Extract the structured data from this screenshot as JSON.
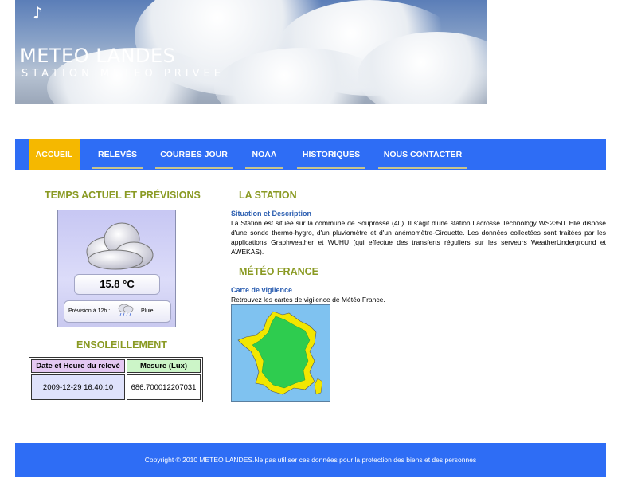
{
  "banner": {
    "note_symbol": "♪",
    "title": "METEO LANDES",
    "subtitle": "STATION METEO PRIVEE"
  },
  "nav": {
    "items": [
      "ACCUEIL",
      "RELEVÉS",
      "COURBES JOUR",
      "NOAA",
      "HISTORIQUES",
      "NOUS CONTACTER"
    ],
    "active": "ACCUEIL"
  },
  "left": {
    "weather_heading": "TEMPS ACTUEL ET PRÉVISIONS",
    "temperature": "15.8 °C",
    "forecast_label": "Prévision à 12h :",
    "forecast_value": "Pluie",
    "sun_heading": "ENSOLEILLEMENT",
    "sun_table": {
      "headers": [
        "Date et Heure du relevé",
        "Mesure (Lux)"
      ],
      "rows": [
        [
          "2009-12-29 16:40:10",
          "686.700012207031"
        ]
      ]
    }
  },
  "right": {
    "station_heading": "LA STATION",
    "station_sub": "Situation et Description",
    "station_text": "La Station est située sur la commune de Souprosse (40). Il s'agit d'une station Lacrosse Technology WS2350. Elle dispose d'une sonde thermo-hygro, d'un pluviomètre et d'un anémomètre-Girouette. Les données collectées sont traitées par les applications Graphweather et WUHU (qui effectue des transferts réguliers sur les serveurs WeatherUnderground et AWEKAS).",
    "france_heading": "MÉTÉO FRANCE",
    "france_sub": "Carte de vigilence",
    "france_text": "Retrouvez les cartes de vigilence de Météo France."
  },
  "footer": {
    "text": "Copyright © 2010 METEO LANDES.Ne pas utiliser ces données pour la protection des biens et des personnes"
  },
  "colors": {
    "nav_blue": "#2e6df5",
    "active_tab": "#f5b800",
    "heading_green": "#8a9a23",
    "map_green": "#2ecc4f",
    "map_yellow": "#f2e600"
  }
}
